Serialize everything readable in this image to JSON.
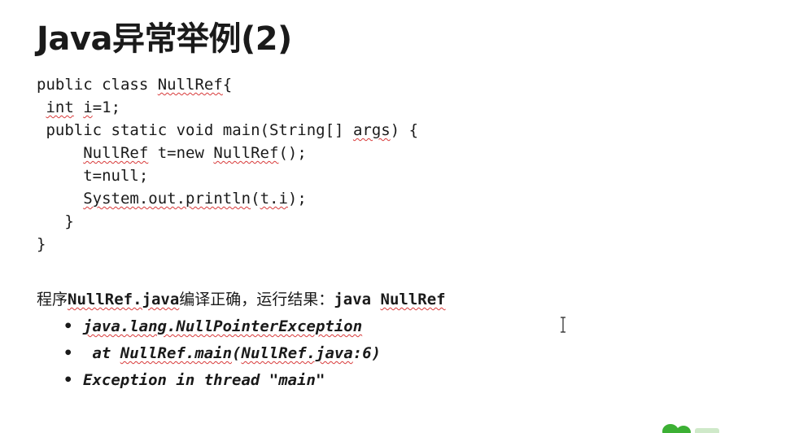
{
  "slide": {
    "title": "Java异常举例(2)"
  },
  "code": {
    "l1_a": "public class ",
    "l1_b": "NullRef",
    "l1_c": "{",
    "l2_a": " ",
    "l2_b": "int",
    "l2_c": " ",
    "l2_d": "i",
    "l2_e": "=1;",
    "l3_a": " public static void main(String[] ",
    "l3_b": "args",
    "l3_c": ") {",
    "l4_a": "     ",
    "l4_b": "NullRef",
    "l4_c": " t=new ",
    "l4_d": "NullRef",
    "l4_e": "();",
    "l5": "     t=null;",
    "l6_a": "     ",
    "l6_b": "System.out.println",
    "l6_c": "(",
    "l6_d": "t.i",
    "l6_e": ");",
    "l7": "   }",
    "l8": "}"
  },
  "result": {
    "prefix": "程序",
    "file": "NullRef.java",
    "middle": "编译正确，运行结果：",
    "command_a": "java ",
    "command_b": "NullRef"
  },
  "bullets": {
    "dot": "•",
    "b1": "java.lang.NullPointerException",
    "b2_a": " at ",
    "b2_b": "NullRef.main",
    "b2_c": "(",
    "b2_d": "NullRef.java",
    "b2_e": ":6)",
    "b3": "Exception in thread \"main\""
  },
  "colors": {
    "text": "#1a1a1a",
    "squiggle": "#d83a3a",
    "watermark": "#3cb034"
  },
  "icons": {
    "cursor": "text-cursor-icon",
    "watermark": "watermark-logo-icon"
  }
}
